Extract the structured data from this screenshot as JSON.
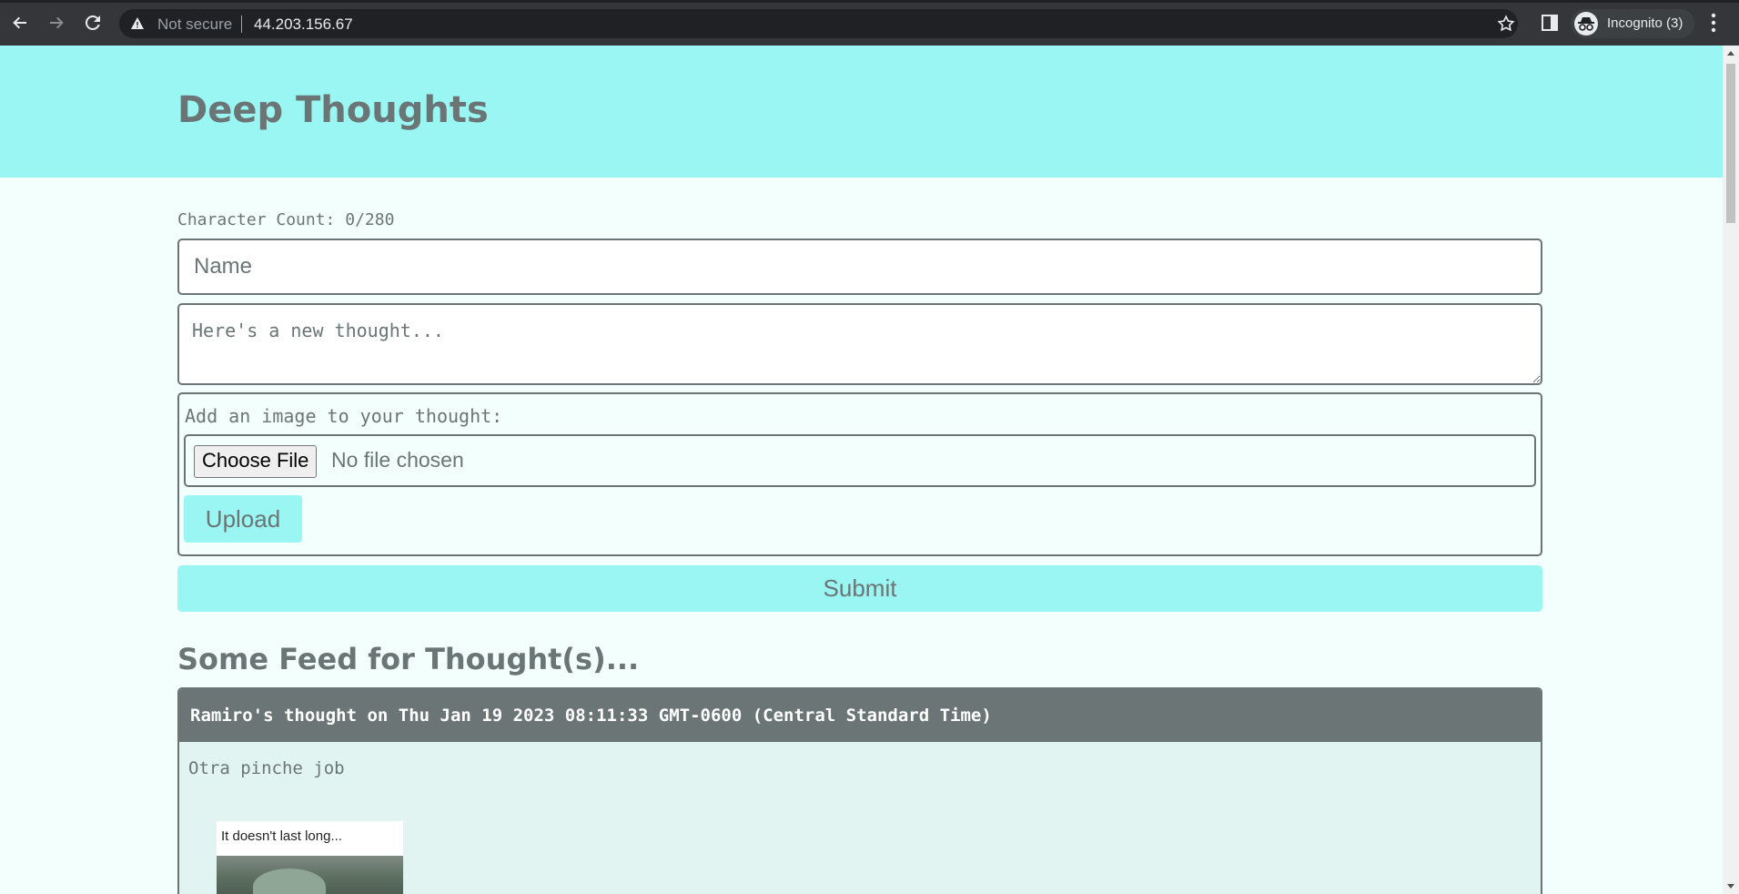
{
  "browser": {
    "security_label": "Not secure",
    "url": "44.203.156.67",
    "profile_label": "Incognito (3)",
    "icons": [
      "back-icon",
      "forward-icon",
      "reload-icon",
      "warning-icon",
      "star-icon",
      "side-panel-icon",
      "incognito-icon",
      "kebab-menu-icon"
    ]
  },
  "header": {
    "title": "Deep Thoughts"
  },
  "form": {
    "char_count": "Character Count: 0/280",
    "name_placeholder": "Name",
    "thought_placeholder": "Here's a new thought...",
    "image_label": "Add an image to your thought:",
    "choose_file_label": "Choose File",
    "file_status": "No file chosen",
    "upload_label": "Upload",
    "submit_label": "Submit"
  },
  "feed": {
    "title": "Some Feed for Thought(s)...",
    "thoughts": [
      {
        "header": "Ramiro's thought on Thu Jan 19 2023 08:11:33 GMT-0600 (Central Standard Time)",
        "text": "Otra pinche job",
        "image_caption": "It doesn't last long..."
      }
    ]
  },
  "colors": {
    "header_bg": "#9af6f2",
    "page_bg": "#f3fffd",
    "text": "#6b7575",
    "card_header_bg": "#6b7575"
  }
}
